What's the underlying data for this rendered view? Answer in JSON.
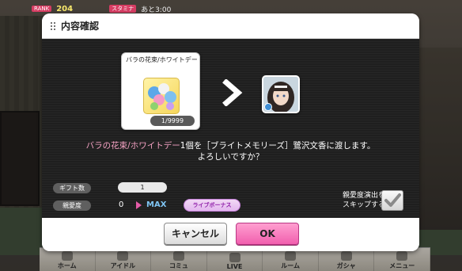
{
  "status": {
    "rank_chip": "RANK",
    "currency": "204",
    "stamina_chip": "スタミナ",
    "stamina_timer": "あと3:00"
  },
  "dialog": {
    "title": "内容確認",
    "item": {
      "name": "バラの花束/ホワイトデー",
      "count": "1/9999"
    },
    "message": {
      "item_name": "バラの花束/ホワイトデー",
      "line1_rest": "1個を［ブライトメモリーズ］鷺沢文香に渡します。",
      "line2": "よろしいですか？"
    },
    "stats": {
      "gift_label": "ギフト数",
      "gift_value": "1",
      "affection_label": "親愛度",
      "affection_current": "0",
      "affection_max": "MAX",
      "bonus_badge": "ライブボーナス"
    },
    "skip": {
      "label_line1": "親愛度演出を",
      "label_line2": "スキップする",
      "checked": true
    },
    "buttons": {
      "cancel": "キャンセル",
      "ok": "OK"
    }
  },
  "bottom_nav": {
    "items": [
      "ホーム",
      "アイドル",
      "コミュ",
      "LIVE",
      "ルーム",
      "ガシャ",
      "メニュー"
    ]
  },
  "colors": {
    "accent_pink": "#f15fae",
    "item_highlight": "#f6a3c4",
    "max_blue": "#7fc4f2"
  }
}
